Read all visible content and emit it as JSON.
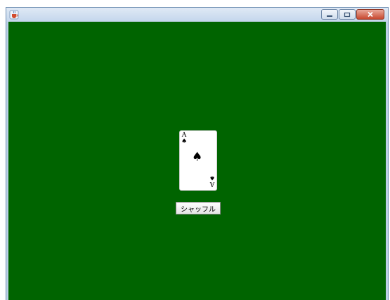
{
  "window": {
    "icons": {
      "app": "java-cup-icon",
      "minimize": "minimize-icon",
      "maximize": "maximize-icon",
      "close": "close-icon"
    }
  },
  "table": {
    "felt_color": "#006400",
    "card": {
      "rank": "A",
      "suit": "♠",
      "suit_name": "spades"
    },
    "shuffle_button_label": "シャッフル"
  }
}
